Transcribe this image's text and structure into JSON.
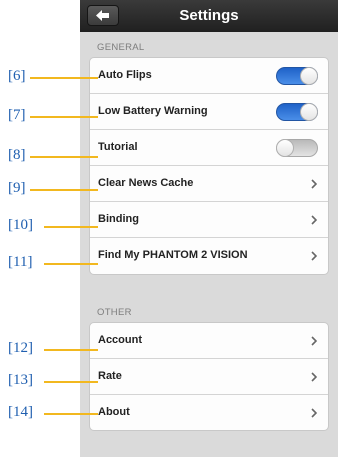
{
  "navbar": {
    "title": "Settings",
    "back_icon": "back-arrow-icon"
  },
  "sections": [
    {
      "header": "GENERAL",
      "rows": [
        {
          "label": "Auto Flips",
          "control": "toggle",
          "state": "on"
        },
        {
          "label": "Low Battery Warning",
          "control": "toggle",
          "state": "on"
        },
        {
          "label": "Tutorial",
          "control": "toggle",
          "state": "off"
        },
        {
          "label": "Clear News Cache",
          "control": "chevron"
        },
        {
          "label": "Binding",
          "control": "chevron"
        },
        {
          "label": "Find My PHANTOM 2 VISION",
          "control": "chevron"
        }
      ]
    },
    {
      "header": "OTHER",
      "rows": [
        {
          "label": "Account",
          "control": "chevron"
        },
        {
          "label": "Rate",
          "control": "chevron"
        },
        {
          "label": "About",
          "control": "chevron"
        }
      ]
    }
  ],
  "callouts": [
    "[6]",
    "[7]",
    "[8]",
    "[9]",
    "[10]",
    "[11]",
    "[12]",
    "[13]",
    "[14]"
  ],
  "colors": {
    "toggle_on": "#2f74d8",
    "callout_text": "#1f5fb0",
    "callout_line": "#f2b81f",
    "navbar": "#2a2a2a"
  }
}
